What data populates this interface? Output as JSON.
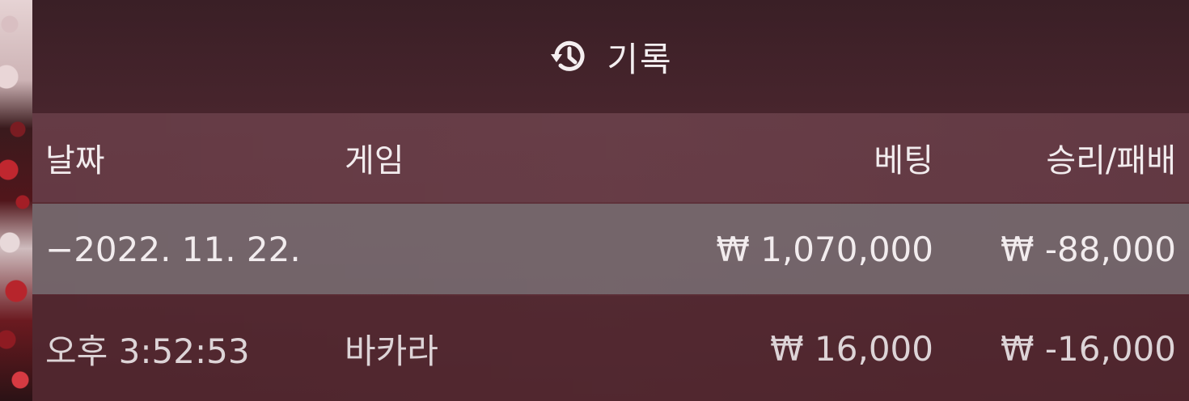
{
  "header": {
    "title": "기록",
    "icon": "history-icon"
  },
  "columns": {
    "date": "날짜",
    "game": "게임",
    "bet": "베팅",
    "result": "승리/패배"
  },
  "rows": [
    {
      "date": "−2022. 11. 22.",
      "game": "",
      "bet": "₩ 1,070,000",
      "result": "₩ -88,000"
    },
    {
      "date": "오후 3:52:53",
      "game": "바카라",
      "bet": "₩ 16,000",
      "result": "₩ -16,000"
    }
  ],
  "colors": {
    "title_bar": "#48252d",
    "header_row": "#6e4650",
    "summary_row": "#786e73",
    "text": "#f2ecee"
  }
}
